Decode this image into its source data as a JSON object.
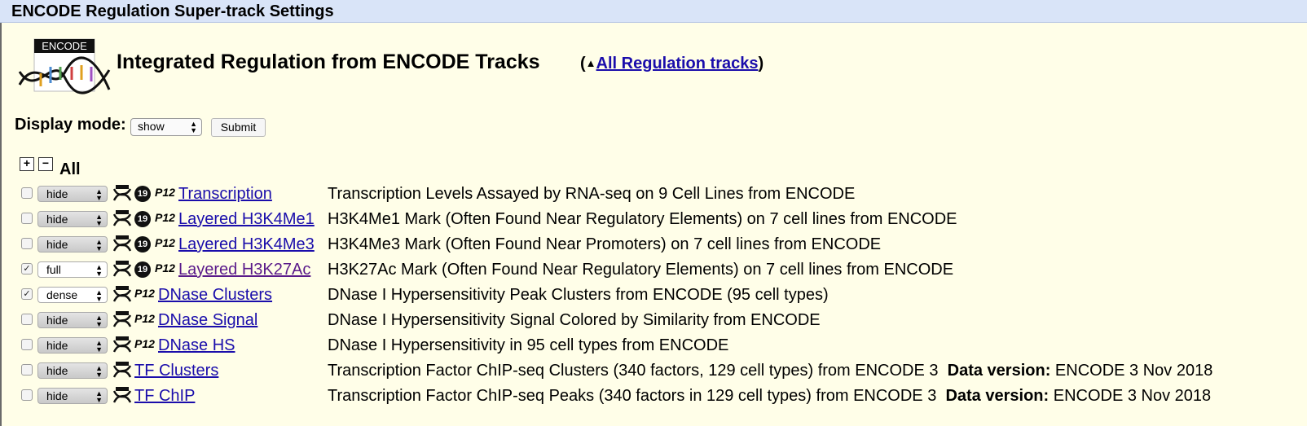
{
  "window": {
    "title": "ENCODE Regulation Super-track Settings"
  },
  "logo": {
    "text": "ENCODE"
  },
  "heading": "Integrated Regulation from ENCODE Tracks",
  "uplink": {
    "open": "(",
    "arrow": "▲",
    "label": "All Regulation tracks",
    "close": ")"
  },
  "display": {
    "label": "Display mode:",
    "value": "show",
    "submit": "Submit"
  },
  "controls": {
    "plus": "+",
    "minus": "−",
    "all": "All"
  },
  "tracks": [
    {
      "checked": false,
      "mode": "hide",
      "has19": true,
      "p12": "P12",
      "name": "Transcription",
      "visited": false,
      "desc": "Transcription Levels Assayed by RNA-seq on 9 Cell Lines from ENCODE",
      "version_label": "",
      "version": ""
    },
    {
      "checked": false,
      "mode": "hide",
      "has19": true,
      "p12": "P12",
      "name": "Layered H3K4Me1",
      "visited": false,
      "desc": "H3K4Me1 Mark (Often Found Near Regulatory Elements) on 7 cell lines from ENCODE",
      "version_label": "",
      "version": ""
    },
    {
      "checked": false,
      "mode": "hide",
      "has19": true,
      "p12": "P12",
      "name": "Layered H3K4Me3",
      "visited": false,
      "desc": "H3K4Me3 Mark (Often Found Near Promoters) on 7 cell lines from ENCODE",
      "version_label": "",
      "version": ""
    },
    {
      "checked": true,
      "mode": "full",
      "has19": true,
      "p12": "P12",
      "name": "Layered H3K27Ac",
      "visited": true,
      "desc": "H3K27Ac Mark (Often Found Near Regulatory Elements) on 7 cell lines from ENCODE",
      "version_label": "",
      "version": ""
    },
    {
      "checked": true,
      "mode": "dense",
      "has19": false,
      "p12": "P12",
      "name": "DNase Clusters",
      "visited": false,
      "desc": "DNase I Hypersensitivity Peak Clusters from ENCODE (95 cell types)",
      "version_label": "",
      "version": ""
    },
    {
      "checked": false,
      "mode": "hide",
      "has19": false,
      "p12": "P12",
      "name": "DNase Signal",
      "visited": false,
      "desc": "DNase I Hypersensitivity Signal Colored by Similarity from ENCODE",
      "version_label": "",
      "version": ""
    },
    {
      "checked": false,
      "mode": "hide",
      "has19": false,
      "p12": "P12",
      "name": "DNase HS",
      "visited": false,
      "desc": "DNase I Hypersensitivity in 95 cell types from ENCODE",
      "version_label": "",
      "version": ""
    },
    {
      "checked": false,
      "mode": "hide",
      "has19": false,
      "p12": "",
      "name": "TF Clusters",
      "visited": false,
      "desc": "Transcription Factor ChIP-seq Clusters (340 factors, 129 cell types) from ENCODE 3",
      "version_label": "Data version:",
      "version": "ENCODE 3 Nov 2018"
    },
    {
      "checked": false,
      "mode": "hide",
      "has19": false,
      "p12": "",
      "name": "TF ChIP",
      "visited": false,
      "desc": "Transcription Factor ChIP-seq Peaks (340 factors in 129 cell types) from ENCODE 3",
      "version_label": "Data version:",
      "version": "ENCODE 3 Nov 2018"
    }
  ]
}
